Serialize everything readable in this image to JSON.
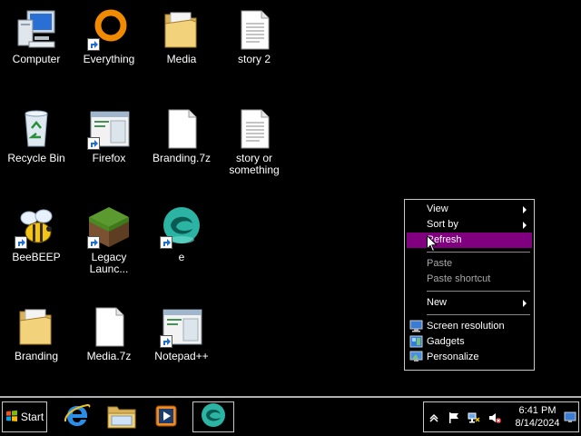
{
  "desktop": {
    "icons": [
      {
        "label": "Computer"
      },
      {
        "label": "Everything"
      },
      {
        "label": "Media"
      },
      {
        "label": "story 2"
      },
      {
        "label": "Recycle Bin"
      },
      {
        "label": "Firefox"
      },
      {
        "label": "Branding.7z"
      },
      {
        "label": "story or something"
      },
      {
        "label": "BeeBEEP"
      },
      {
        "label": "Legacy Launc..."
      },
      {
        "label": "e"
      },
      {
        "label": "Branding"
      },
      {
        "label": "Media.7z"
      },
      {
        "label": "Notepad++"
      }
    ]
  },
  "context_menu": {
    "items": [
      {
        "label": "View"
      },
      {
        "label": "Sort by"
      },
      {
        "label": "Refresh"
      },
      {
        "label": "Paste"
      },
      {
        "label": "Paste shortcut"
      },
      {
        "label": "New"
      },
      {
        "label": "Screen resolution"
      },
      {
        "label": "Gadgets"
      },
      {
        "label": "Personalize"
      }
    ],
    "highlight_color": "#800080"
  },
  "taskbar": {
    "start_label": "Start",
    "pinned": [
      "internet-explorer-icon",
      "file-explorer-icon",
      "media-player-icon",
      "teal-app-icon"
    ],
    "clock": {
      "time": "6:41 PM",
      "date": "8/14/2024"
    }
  }
}
